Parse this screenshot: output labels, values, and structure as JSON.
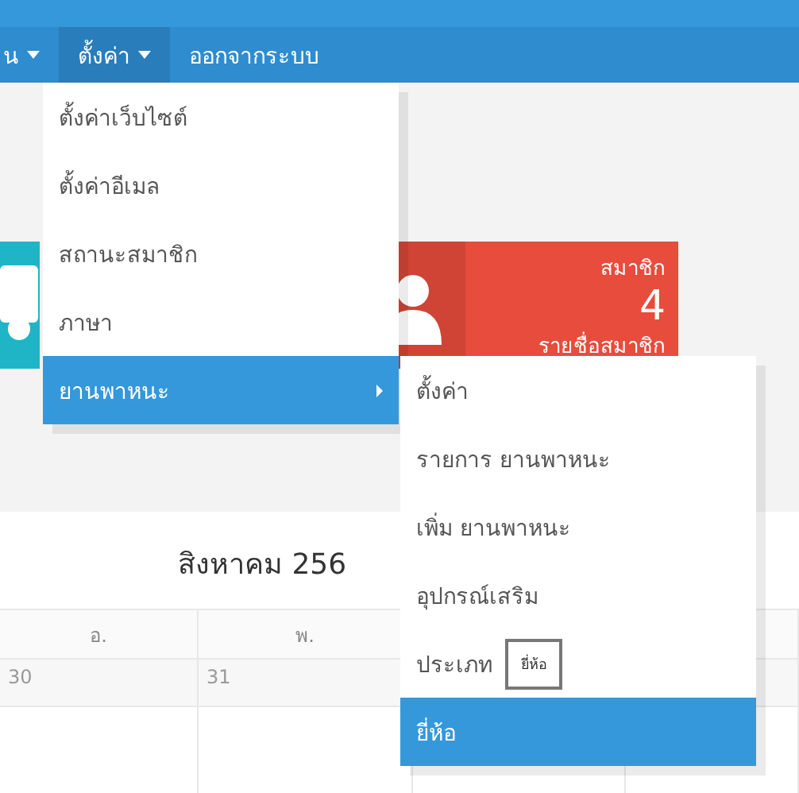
{
  "nav": [
    {
      "label": "น",
      "caret": true,
      "selected": false
    },
    {
      "label": "ตั้งค่า",
      "caret": true,
      "selected": true
    },
    {
      "label": "ออกจากระบบ",
      "caret": false,
      "selected": false
    }
  ],
  "menu": [
    {
      "label": "ตั้งค่าเว็บไซต์",
      "selected": false,
      "submenu": false
    },
    {
      "label": "ตั้งค่าอีเมล",
      "selected": false,
      "submenu": false
    },
    {
      "label": "สถานะสมาชิก",
      "selected": false,
      "submenu": false
    },
    {
      "label": "ภาษา",
      "selected": false,
      "submenu": false
    },
    {
      "label": "ยานพาหนะ",
      "selected": true,
      "submenu": true
    }
  ],
  "submenu": [
    {
      "label": "ตั้งค่า",
      "selected": false
    },
    {
      "label": "รายการ ยานพาหนะ",
      "selected": false
    },
    {
      "label": "เพิ่ม ยานพาหนะ",
      "selected": false
    },
    {
      "label": "อุปกรณ์เสริม",
      "selected": false
    },
    {
      "label": "ประเภท",
      "selected": false,
      "tooltip": "ยี่ห้อ"
    },
    {
      "label": "ยี่ห้อ",
      "selected": true
    }
  ],
  "cards": [
    {
      "kind": "vehicle",
      "color": "#1fb5c6"
    },
    {
      "kind": "member",
      "color": "#e74c3c",
      "title": "สมาชิก",
      "value": "4",
      "link": "รายชื่อสมาชิก"
    }
  ],
  "calendar": {
    "title": "สิงหาคม 256",
    "headers": [
      "อ.",
      "พ."
    ],
    "dates": [
      "30",
      "31"
    ]
  }
}
